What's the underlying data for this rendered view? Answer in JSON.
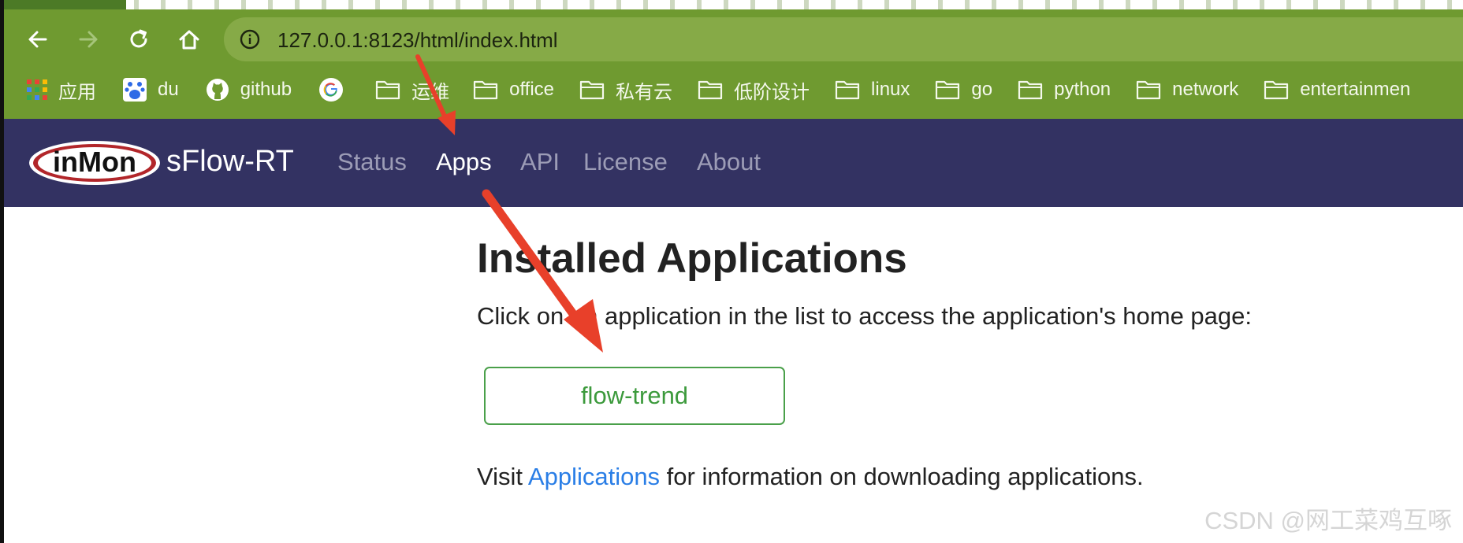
{
  "browser": {
    "url": "127.0.0.1:8123/html/index.html",
    "bookmarks": [
      {
        "label": "应用",
        "icon": "apps-grid-icon"
      },
      {
        "label": "du",
        "icon": "baidu-paw-icon"
      },
      {
        "label": "github",
        "icon": "github-icon"
      },
      {
        "label": "",
        "icon": "google-icon"
      },
      {
        "label": "运维",
        "icon": "folder-icon"
      },
      {
        "label": "office",
        "icon": "folder-icon"
      },
      {
        "label": "私有云",
        "icon": "folder-icon"
      },
      {
        "label": "低阶设计",
        "icon": "folder-icon"
      },
      {
        "label": "linux",
        "icon": "folder-icon"
      },
      {
        "label": "go",
        "icon": "folder-icon"
      },
      {
        "label": "python",
        "icon": "folder-icon"
      },
      {
        "label": "network",
        "icon": "folder-icon"
      },
      {
        "label": "entertainmen",
        "icon": "folder-icon"
      }
    ]
  },
  "navbar": {
    "logo_text": "inMon",
    "brand": "sFlow-RT",
    "links": [
      {
        "label": "Status",
        "active": false
      },
      {
        "label": "Apps",
        "active": true
      },
      {
        "label": "API",
        "active": false
      },
      {
        "label": "License",
        "active": false
      },
      {
        "label": "About",
        "active": false
      }
    ]
  },
  "content": {
    "heading": "Installed Applications",
    "intro": "Click on an application in the list to access the application's home page:",
    "app_button": "flow-trend",
    "footer_prefix": "Visit ",
    "footer_link": "Applications",
    "footer_suffix": " for information on downloading applications."
  },
  "watermark": "CSDN @网工菜鸡互啄",
  "colors": {
    "chrome_bg": "#6f9a30",
    "navbar_bg": "#333262",
    "app_button_green": "#4aa04a",
    "link_blue": "#2a7ee6",
    "annotation_arrow": "#e8402a"
  }
}
